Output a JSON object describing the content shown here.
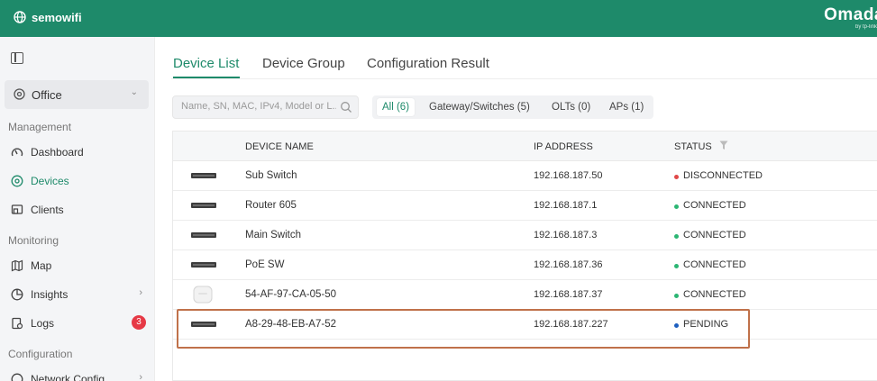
{
  "header": {
    "site_name": "semowifi",
    "brand": "Omada",
    "brand_sub": "by tp-link"
  },
  "sidebar": {
    "site_selector": "Office",
    "sections": {
      "management": "Management",
      "monitoring": "Monitoring",
      "configuration": "Configuration"
    },
    "items": [
      {
        "label": "Dashboard",
        "icon": "gauge-icon"
      },
      {
        "label": "Devices",
        "icon": "devices-icon",
        "active": true
      },
      {
        "label": "Clients",
        "icon": "clients-icon"
      },
      {
        "label": "Map",
        "icon": "map-icon"
      },
      {
        "label": "Insights",
        "icon": "insights-icon"
      },
      {
        "label": "Logs",
        "icon": "logs-icon",
        "badge": "3"
      },
      {
        "label": "Network Config",
        "icon": "network-config-icon"
      }
    ]
  },
  "tabs": [
    {
      "label": "Device List",
      "active": true
    },
    {
      "label": "Device Group"
    },
    {
      "label": "Configuration Result"
    }
  ],
  "search": {
    "placeholder": "Name, SN, MAC, IPv4, Model or L..."
  },
  "filters": [
    {
      "label": "All (6)",
      "active": true
    },
    {
      "label": "Gateway/Switches (5)"
    },
    {
      "label": "OLTs (0)"
    },
    {
      "label": "APs (1)"
    }
  ],
  "table": {
    "columns": {
      "name": "DEVICE NAME",
      "ip": "IP ADDRESS",
      "status": "STATUS"
    },
    "rows": [
      {
        "name": "Sub Switch",
        "ip": "192.168.187.50",
        "status": "DISCONNECTED",
        "status_color": "#e04848",
        "type": "switch"
      },
      {
        "name": "Router 605",
        "ip": "192.168.187.1",
        "status": "CONNECTED",
        "status_color": "#2bb673",
        "type": "router"
      },
      {
        "name": "Main Switch",
        "ip": "192.168.187.3",
        "status": "CONNECTED",
        "status_color": "#2bb673",
        "type": "switch"
      },
      {
        "name": "PoE SW",
        "ip": "192.168.187.36",
        "status": "CONNECTED",
        "status_color": "#2bb673",
        "type": "switch"
      },
      {
        "name": "54-AF-97-CA-05-50",
        "ip": "192.168.187.37",
        "status": "CONNECTED",
        "status_color": "#2bb673",
        "type": "ap"
      },
      {
        "name": "A8-29-48-EB-A7-52",
        "ip": "192.168.187.227",
        "status": "PENDING",
        "status_color": "#1d5fbf",
        "type": "switch"
      }
    ]
  },
  "colors": {
    "brand": "#1e8a6a",
    "badge": "#e63946",
    "highlight": "#c0714a"
  }
}
